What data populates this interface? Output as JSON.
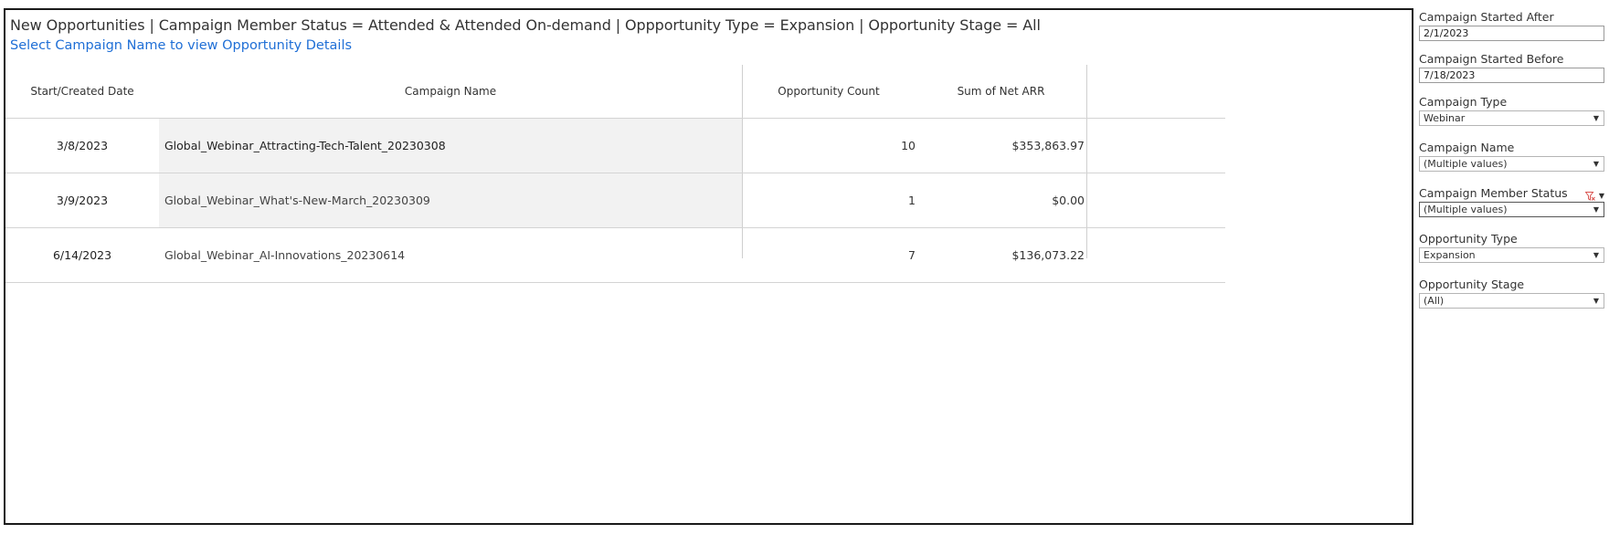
{
  "viz": {
    "title": "New Opportunities | Campaign Member Status = Attended & Attended On-demand | Oppportunity Type = Expansion | Opportunity Stage = All",
    "subtitle": "Select Campaign Name to view Opportunity Details"
  },
  "table": {
    "headers": {
      "date": "Start/Created Date",
      "name": "Campaign Name",
      "count": "Opportunity Count",
      "arr": "Sum of Net ARR"
    },
    "rows": [
      {
        "date": "3/8/2023",
        "name": "Global_Webinar_Attracting-Tech-Talent_20230308",
        "count": "10",
        "arr": "$353,863.97"
      },
      {
        "date": "3/9/2023",
        "name": "Global_Webinar_What's-New-March_20230309",
        "count": "1",
        "arr": "$0.00"
      },
      {
        "date": "6/14/2023",
        "name": "Global_Webinar_AI-Innovations_20230614",
        "count": "7",
        "arr": "$136,073.22"
      }
    ]
  },
  "filters": {
    "started_after": {
      "label": "Campaign Started After",
      "value": "2/1/2023"
    },
    "started_before": {
      "label": "Campaign Started Before",
      "value": "7/18/2023"
    },
    "campaign_type": {
      "label": "Campaign Type",
      "value": "Webinar"
    },
    "campaign_name": {
      "label": "Campaign Name",
      "value": "(Multiple values)"
    },
    "member_status": {
      "label": "Campaign Member Status",
      "value": "(Multiple values)"
    },
    "opportunity_type": {
      "label": "Opportunity Type",
      "value": "Expansion"
    },
    "opportunity_stage": {
      "label": "Opportunity Stage",
      "value": "(All)"
    }
  },
  "colors": {
    "subtitle_link": "#1f6fd6",
    "clear_filter_icon": "#d9534f",
    "name_cell_bg": "#f2f2f2"
  }
}
